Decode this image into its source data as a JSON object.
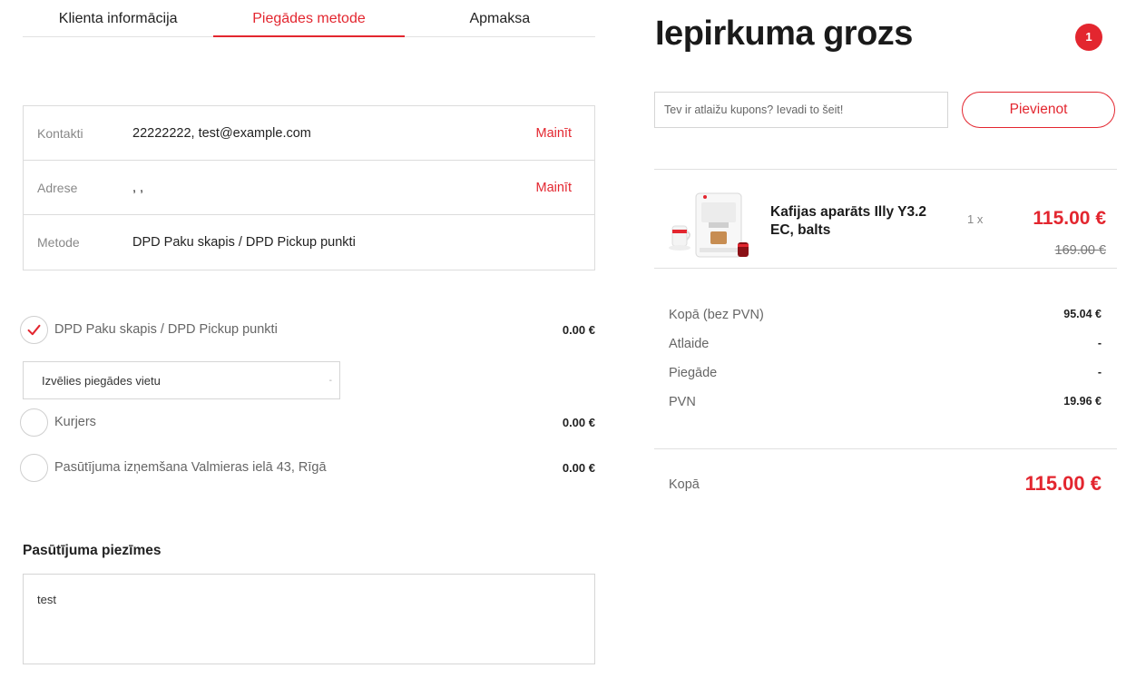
{
  "tabs": [
    {
      "label": "Klienta informācija",
      "active": false
    },
    {
      "label": "Piegādes metode",
      "active": true
    },
    {
      "label": "Apmaksa",
      "active": false
    }
  ],
  "summary": {
    "rows": [
      {
        "label": "Kontakti",
        "value": "22222222, test@example.com",
        "action": "Mainīt"
      },
      {
        "label": "Adrese",
        "value": ", ,",
        "action": "Mainīt"
      },
      {
        "label": "Metode",
        "value": "DPD Paku skapis / DPD Pickup punkti",
        "action": ""
      }
    ]
  },
  "shipping": {
    "methods": [
      {
        "label": "DPD Paku skapis / DPD Pickup punkti",
        "price": "0.00 €",
        "selected": true
      },
      {
        "label": "Kurjers",
        "price": "0.00 €",
        "selected": false
      },
      {
        "label": "Pasūtījuma izņemšana Valmieras ielā 43, Rīgā",
        "price": "0.00 €",
        "selected": false
      }
    ],
    "pickup_select": {
      "value": "Izvēlies piegādes vietu",
      "arrow": "-"
    }
  },
  "notes": {
    "title": "Pasūtījuma piezīmes",
    "value": "test"
  },
  "cart": {
    "title": "Iepirkuma grozs",
    "badge": "1",
    "coupon": {
      "placeholder": "Tev ir atlaižu kupons? Ievadi to šeit!",
      "button": "Pievienot"
    },
    "item": {
      "name": "Kafijas aparāts Illy Y3.2 EC, balts",
      "qty": "1 x",
      "price": "115.00 €",
      "old_price": "169.00 €",
      "image_icon": "coffee-machine-icon"
    },
    "totals": [
      {
        "label": "Kopā (bez PVN)",
        "value": "95.04 €"
      },
      {
        "label": "Atlaide",
        "value": "-"
      },
      {
        "label": "Piegāde",
        "value": "-"
      },
      {
        "label": "PVN",
        "value": "19.96 €"
      }
    ],
    "grand_total": {
      "label": "Kopā",
      "value": "115.00 €"
    }
  },
  "colors": {
    "accent": "#e3262f",
    "border": "#dcdcdc",
    "muted": "#888888"
  }
}
